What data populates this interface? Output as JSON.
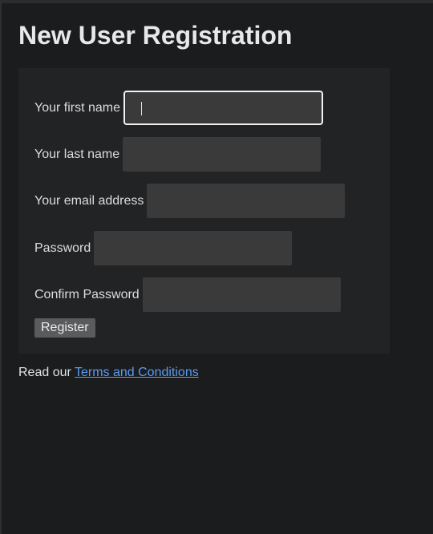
{
  "page": {
    "title": "New User Registration"
  },
  "form": {
    "fields": [
      {
        "label": "Your first name",
        "value": "",
        "focused": true
      },
      {
        "label": "Your last name",
        "value": ""
      },
      {
        "label": "Your email address",
        "value": ""
      },
      {
        "label": "Password",
        "value": ""
      },
      {
        "label": "Confirm Password",
        "value": ""
      }
    ],
    "register_label": "Register"
  },
  "footer": {
    "prefix": "Read our ",
    "link_text": "Terms and Conditions"
  },
  "colors": {
    "background": "#1b1c1e",
    "panel": "#212325",
    "input": "#3a3a3b",
    "link": "#5a9bf0"
  }
}
